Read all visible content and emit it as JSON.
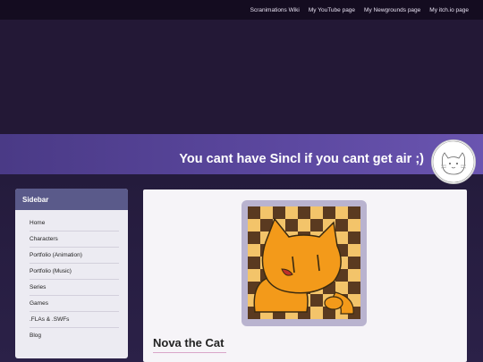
{
  "topnav": {
    "links": [
      "Scranimations Wiki",
      "My YouTube page",
      "My Newgrounds page",
      "My itch.io page"
    ]
  },
  "banner": {
    "tagline": "You cant have Sincl if you cant get air ;)"
  },
  "sidebar": {
    "header": "Sidebar",
    "items": [
      "Home",
      "Characters",
      "Portfolio (Animation)",
      "Portfolio (Music)",
      "Series",
      "Games",
      ".FLAs & .SWFs",
      "Blog"
    ]
  },
  "main": {
    "title": "Nova the Cat"
  },
  "colors": {
    "nav_bg": "#140c20",
    "banner_accent": "#5c48a0",
    "cat_orange": "#f39a1a",
    "checker_dark": "#5a3a20",
    "checker_light": "#f3c46a"
  },
  "icons": {
    "avatar": "cat-sketch-avatar",
    "portrait": "orange-cat-portrait"
  }
}
